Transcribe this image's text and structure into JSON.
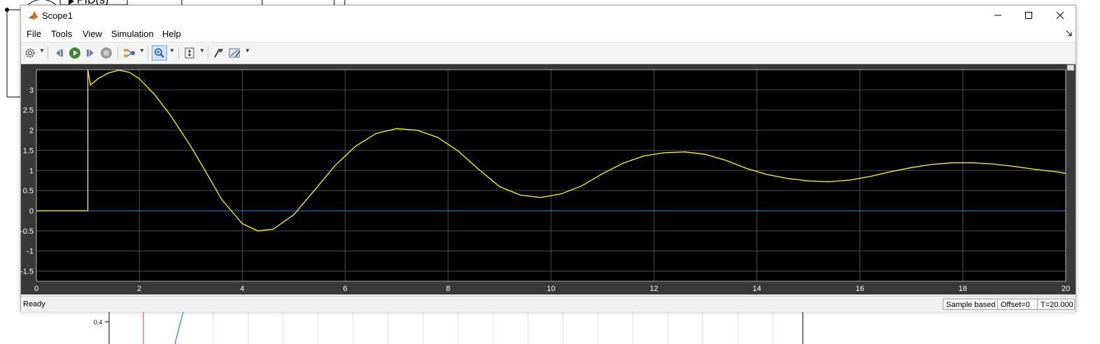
{
  "window": {
    "title": "Scope1",
    "menus": [
      "File",
      "Tools",
      "View",
      "Simulation",
      "Help"
    ]
  },
  "toolbar": {
    "icons": [
      "settings-icon",
      "step-back-icon",
      "run-icon",
      "step-forward-icon",
      "stop-icon",
      "highlight-signal-icon",
      "zoom-in-icon",
      "autoscale-icon",
      "style-icon",
      "measurements-icon"
    ],
    "active_tool": "zoom-in-icon"
  },
  "background_model": {
    "block_label": "PID(s)",
    "axis_tick_label": "0.4"
  },
  "status": {
    "text": "Ready",
    "sample_mode": "Sample based",
    "offset": "Offset=0",
    "time": "T=20.000"
  },
  "colors": {
    "plot_background": "#000000",
    "grid": "#4d4d4d",
    "signal_1": "#ffff00",
    "signal_2": "#0072bd"
  },
  "chart_data": {
    "type": "line",
    "xlim": [
      0,
      20
    ],
    "ylim": [
      -1.75,
      3.5
    ],
    "grid": true,
    "x_ticks": [
      "0",
      "2",
      "4",
      "6",
      "8",
      "10",
      "12",
      "14",
      "16",
      "18",
      "20"
    ],
    "y_ticks": [
      "3",
      "2.5",
      "2",
      "1.5",
      "1",
      "0.5",
      "0",
      "-0.5",
      "-1",
      "-1.5"
    ],
    "x_tick_values": [
      0,
      2,
      4,
      6,
      8,
      10,
      12,
      14,
      16,
      18,
      20
    ],
    "y_tick_values": [
      3,
      2.5,
      2,
      1.5,
      1,
      0.5,
      0,
      -0.5,
      -1,
      -1.5
    ],
    "series": [
      {
        "color": "#ffff00",
        "x": [
          0,
          1,
          1,
          1.05,
          1.2,
          1.4,
          1.6,
          1.8,
          2.0,
          2.3,
          2.6,
          3.0,
          3.3,
          3.6,
          4.0,
          4.3,
          4.6,
          5.0,
          5.4,
          5.8,
          6.2,
          6.6,
          7.0,
          7.4,
          7.8,
          8.2,
          8.6,
          9.0,
          9.4,
          9.8,
          10.2,
          10.6,
          11.0,
          11.4,
          11.8,
          12.2,
          12.6,
          13.0,
          13.4,
          13.8,
          14.2,
          14.6,
          15.0,
          15.4,
          15.8,
          16.2,
          16.6,
          17.0,
          17.4,
          17.8,
          18.2,
          18.6,
          19.0,
          19.4,
          19.8,
          20.0
        ],
        "y": [
          0,
          0,
          3.5,
          3.12,
          3.28,
          3.42,
          3.49,
          3.44,
          3.28,
          2.88,
          2.38,
          1.6,
          0.95,
          0.28,
          -0.32,
          -0.5,
          -0.46,
          -0.1,
          0.5,
          1.12,
          1.6,
          1.92,
          2.04,
          2.0,
          1.82,
          1.48,
          1.02,
          0.6,
          0.39,
          0.33,
          0.42,
          0.62,
          0.92,
          1.18,
          1.36,
          1.44,
          1.46,
          1.4,
          1.25,
          1.05,
          0.9,
          0.8,
          0.74,
          0.72,
          0.76,
          0.85,
          0.97,
          1.07,
          1.15,
          1.19,
          1.19,
          1.16,
          1.1,
          1.03,
          0.97,
          0.93
        ]
      },
      {
        "color": "#0072bd",
        "x": [
          0,
          20
        ],
        "y": [
          0,
          0
        ]
      }
    ]
  }
}
